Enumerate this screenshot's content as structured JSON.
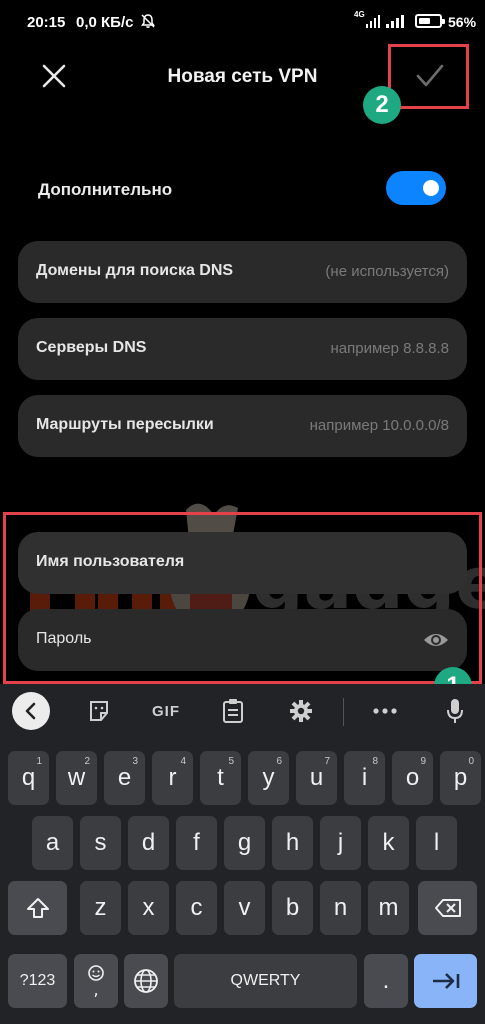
{
  "status_bar": {
    "time": "20:15",
    "speed": "0,0 КБ/с",
    "network": "4G",
    "battery_level": 56,
    "battery_pct": "56%"
  },
  "header": {
    "title": "Новая сеть VPN",
    "close_icon": "close-icon",
    "confirm_icon": "checkmark-icon"
  },
  "annotations": {
    "badge_1": "1",
    "badge_2": "2",
    "highlight_color": "#e4424a",
    "badge_color": "#1ea983"
  },
  "advanced": {
    "label": "Дополнительно",
    "enabled": true,
    "toggle_color": "#0d84ff"
  },
  "fields": [
    {
      "label": "Домены для поиска DNS",
      "placeholder": "(не используется)"
    },
    {
      "label": "Серверы DNS",
      "placeholder": "например 8.8.8.8"
    },
    {
      "label": "Маршруты пересылки",
      "placeholder": "например 10.0.0.0/8"
    },
    {
      "label": "Имя пользователя",
      "placeholder": ""
    },
    {
      "label": "Пароль",
      "placeholder": ""
    }
  ],
  "watermark": {
    "text": "gadget"
  },
  "keyboard": {
    "toolbar": [
      "back-icon",
      "sticker-icon",
      "GIF",
      "clipboard-icon",
      "settings-icon",
      "more-icon",
      "mic-icon"
    ],
    "gif_label": "GIF",
    "row1": [
      {
        "k": "q",
        "h": "1"
      },
      {
        "k": "w",
        "h": "2"
      },
      {
        "k": "e",
        "h": "3"
      },
      {
        "k": "r",
        "h": "4"
      },
      {
        "k": "t",
        "h": "5"
      },
      {
        "k": "y",
        "h": "6"
      },
      {
        "k": "u",
        "h": "7"
      },
      {
        "k": "i",
        "h": "8"
      },
      {
        "k": "o",
        "h": "9"
      },
      {
        "k": "p",
        "h": "0"
      }
    ],
    "row2": [
      "a",
      "s",
      "d",
      "f",
      "g",
      "h",
      "j",
      "k",
      "l"
    ],
    "row3": [
      "z",
      "x",
      "c",
      "v",
      "b",
      "n",
      "m"
    ],
    "symbols_label": "?123",
    "space_label": "QWERTY",
    "period_label": "."
  }
}
